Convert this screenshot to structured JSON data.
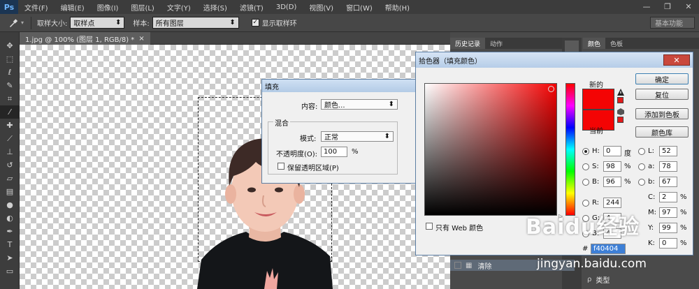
{
  "app": {
    "logo": "Ps"
  },
  "menu": [
    "文件(F)",
    "编辑(E)",
    "图像(I)",
    "图层(L)",
    "文字(Y)",
    "选择(S)",
    "滤镜(T)",
    "3D(D)",
    "视图(V)",
    "窗口(W)",
    "帮助(H)"
  ],
  "window_controls": [
    "—",
    "❐",
    "✕"
  ],
  "options": {
    "sample_size_label": "取样大小:",
    "sample_size_value": "取样点",
    "sample_label": "样本:",
    "sample_value": "所有图层",
    "show_ring_label": "显示取样环",
    "workspace": "基本功能"
  },
  "document": {
    "tab": "1.jpg @ 100% (图层 1, RGB/8) *",
    "close": "×"
  },
  "panels": {
    "history_tab": "历史记录",
    "actions_tab": "动作",
    "color_tab": "颜色",
    "swatches_tab": "色板",
    "layer_clear": "清除",
    "layer_type_search": "类型"
  },
  "fill_dialog": {
    "title": "填充",
    "content_label": "内容:",
    "content_value": "颜色...",
    "blend_group": "混合",
    "mode_label": "模式:",
    "mode_value": "正常",
    "opacity_label": "不透明度(O):",
    "opacity_value": "100",
    "opacity_unit": "%",
    "preserve_label": "保留透明区域(P)"
  },
  "color_picker": {
    "title": "拾色器（填充颜色）",
    "ok": "确定",
    "reset": "复位",
    "add_to_swatches": "添加到色板",
    "color_libraries": "颜色库",
    "new_label": "新的",
    "current_label": "当前",
    "new_color": "#f40404",
    "current_color": "#f40404",
    "web_only_label": "只有 Web 颜色",
    "hsb": {
      "h_label": "H:",
      "h": "0",
      "h_unit": "度",
      "s_label": "S:",
      "s": "98",
      "s_unit": "%",
      "b_label": "B:",
      "b": "96",
      "b_unit": "%"
    },
    "rgb": {
      "r_label": "R:",
      "r": "244",
      "g_label": "G:",
      "g": "4",
      "b_label": "B:",
      "b": "4"
    },
    "lab": {
      "l_label": "L:",
      "l": "52",
      "a_label": "a:",
      "a": "78",
      "b_label": "b:",
      "b": "67"
    },
    "cmyk": {
      "c_label": "C:",
      "c": "2",
      "m_label": "M:",
      "m": "97",
      "y_label": "Y:",
      "y": "99",
      "k_label": "K:",
      "k": "0",
      "unit": "%"
    },
    "hex_label": "#",
    "hex": "f40404"
  },
  "watermark": {
    "brand": "Baidu经验",
    "url": "jingyan.baidu.com"
  }
}
